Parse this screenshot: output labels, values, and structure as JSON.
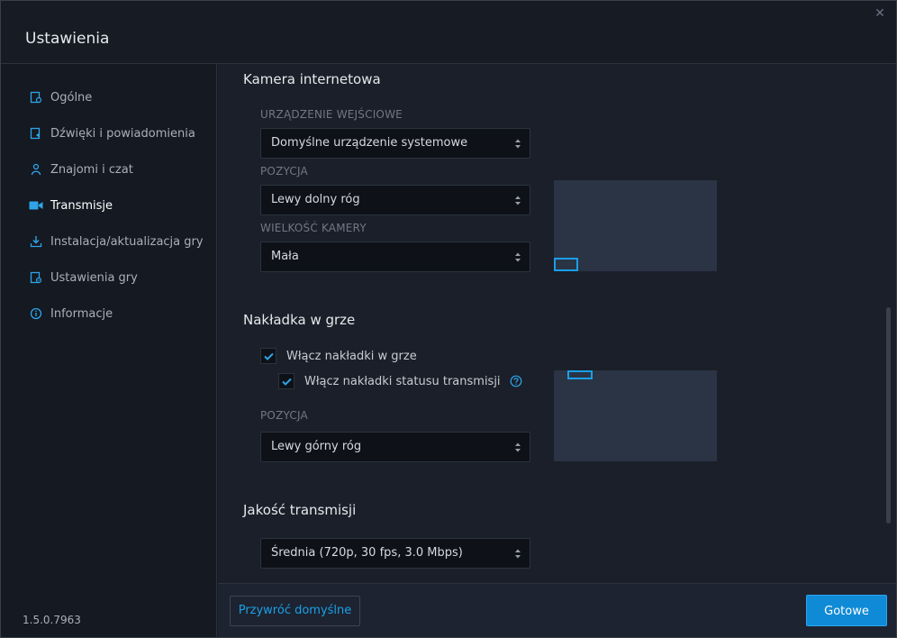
{
  "window": {
    "title": "Ustawienia"
  },
  "sidebar": {
    "items": [
      {
        "label": "Ogólne",
        "icon": "settings-page-icon"
      },
      {
        "label": "Dźwięki i powiadomienia",
        "icon": "sound-icon"
      },
      {
        "label": "Znajomi i czat",
        "icon": "friends-icon"
      },
      {
        "label": "Transmisje",
        "icon": "camera-icon",
        "active": true
      },
      {
        "label": "Instalacja/aktualizacja gry",
        "icon": "download-icon"
      },
      {
        "label": "Ustawienia gry",
        "icon": "game-settings-icon"
      },
      {
        "label": "Informacje",
        "icon": "info-icon"
      }
    ],
    "version": "1.5.0.7963"
  },
  "webcam": {
    "title": "Kamera internetowa",
    "device_label": "URZĄDZENIE WEJŚCIOWE",
    "device_value": "Domyślne urządzenie systemowe",
    "position_label": "POZYCJA",
    "position_value": "Lewy dolny róg",
    "size_label": "WIELKOŚĆ KAMERY",
    "size_value": "Mała"
  },
  "overlay": {
    "title": "Nakładka w grze",
    "enable_overlay_label": "Włącz nakładki w grze",
    "enable_overlay_checked": true,
    "enable_status_label": "Włącz nakładki statusu transmisji",
    "enable_status_checked": true,
    "position_label": "POZYCJA",
    "position_value": "Lewy górny róg"
  },
  "quality": {
    "title": "Jakość transmisji",
    "value": "Średnia (720p, 30 fps, 3.0 Mbps)"
  },
  "footer": {
    "reset_label": "Przywróć domyślne",
    "done_label": "Gotowe"
  },
  "colors": {
    "accent": "#1a9fe8",
    "button": "#0f8ad6",
    "preview": "#2b3445"
  }
}
